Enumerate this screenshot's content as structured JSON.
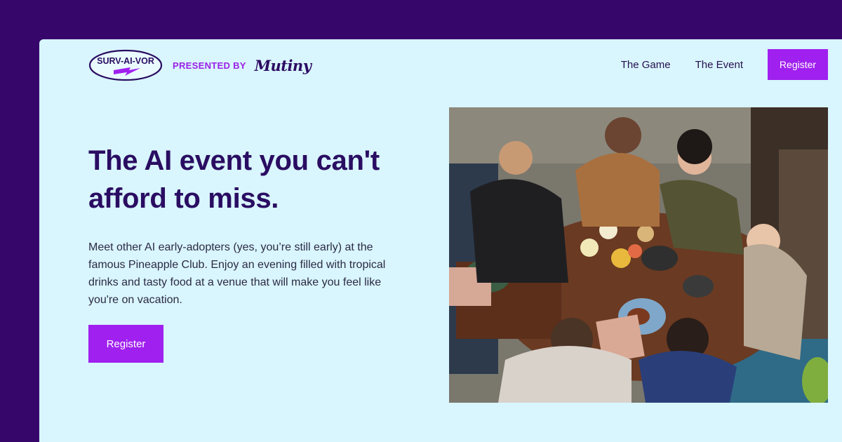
{
  "brand": {
    "logo_text": "SURV-AI-VOR",
    "presented_by": "PRESENTED BY",
    "sponsor": "Mutiny"
  },
  "nav": {
    "items": [
      {
        "label": "The Game"
      },
      {
        "label": "The Event"
      }
    ],
    "register_label": "Register"
  },
  "hero": {
    "title": "The AI event you can't afford to miss.",
    "description": "Meet other AI early-adopters (yes, you’re still early) at the famous Pineapple Club. Enjoy an evening filled with tropical drinks and tasty food at a venue that will make you feel like you're on vacation.",
    "register_label": "Register"
  },
  "colors": {
    "background": "#36066b",
    "card": "#d9f5fd",
    "accent": "#a020ef",
    "heading": "#2a0d62"
  }
}
